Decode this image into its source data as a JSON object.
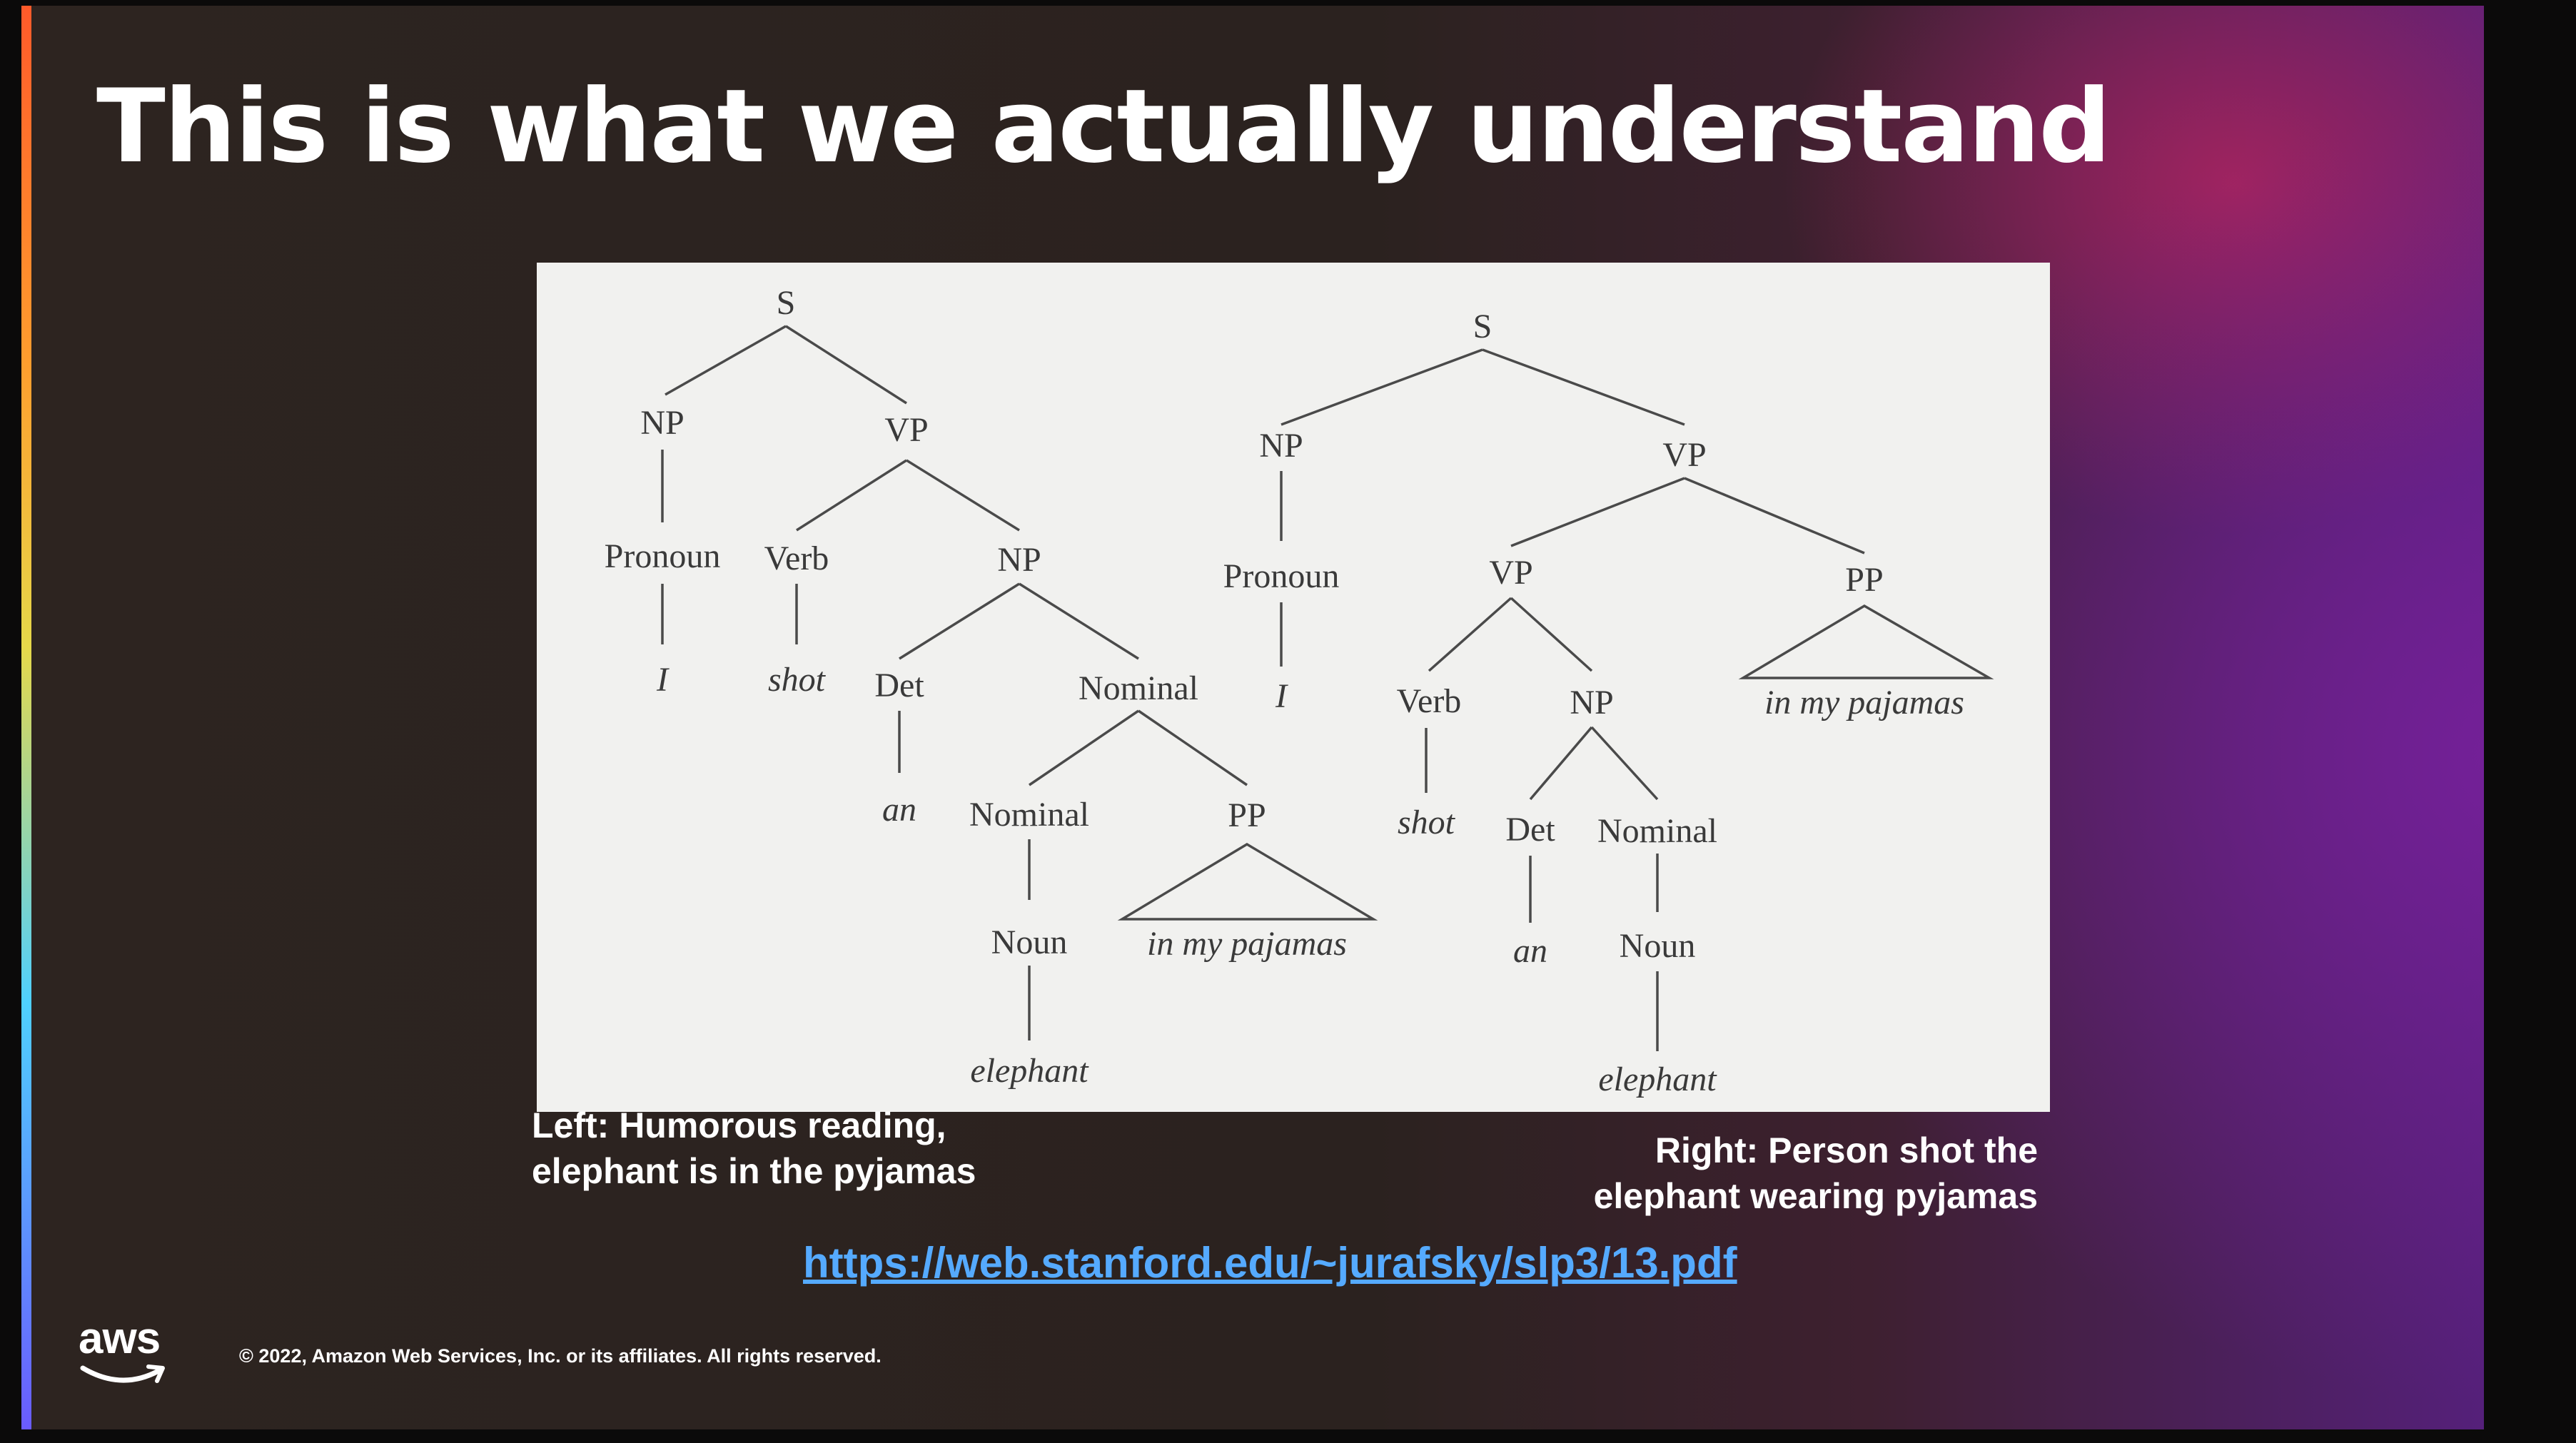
{
  "slide": {
    "title": "This is what we actually understand",
    "caption_left": [
      "Left: Humorous reading,",
      "elephant is in the pyjamas"
    ],
    "caption_right": [
      "Right: Person shot the",
      "elephant wearing pyjamas"
    ],
    "url": "https://web.stanford.edu/~jurafsky/slp3/13.pdf",
    "copyright": "© 2022, Amazon Web Services, Inc. or its affiliates. All rights reserved.",
    "logo_text": "aws"
  },
  "colors": {
    "title": "#ffffff",
    "link": "#55aaff",
    "panel_background": "#f1f1ef",
    "tree_ink": "#3a3a3a",
    "accent_gradient": [
      "#ff5a2a",
      "#ff9d2e",
      "#e6d84a",
      "#4fd0ff",
      "#6a5bff"
    ]
  },
  "trees": {
    "left": {
      "labels": [
        "S",
        "NP",
        "VP",
        "Pronoun",
        "Verb",
        "NP",
        "Det",
        "Nominal",
        "Nominal",
        "PP",
        "Noun"
      ],
      "leaves": [
        "I",
        "shot",
        "an",
        "in my pajamas",
        "elephant"
      ]
    },
    "right": {
      "labels": [
        "S",
        "NP",
        "VP",
        "Pronoun",
        "VP",
        "PP",
        "Verb",
        "NP",
        "Det",
        "Nominal",
        "Noun"
      ],
      "leaves": [
        "I",
        "in my pajamas",
        "shot",
        "an",
        "elephant"
      ]
    }
  }
}
